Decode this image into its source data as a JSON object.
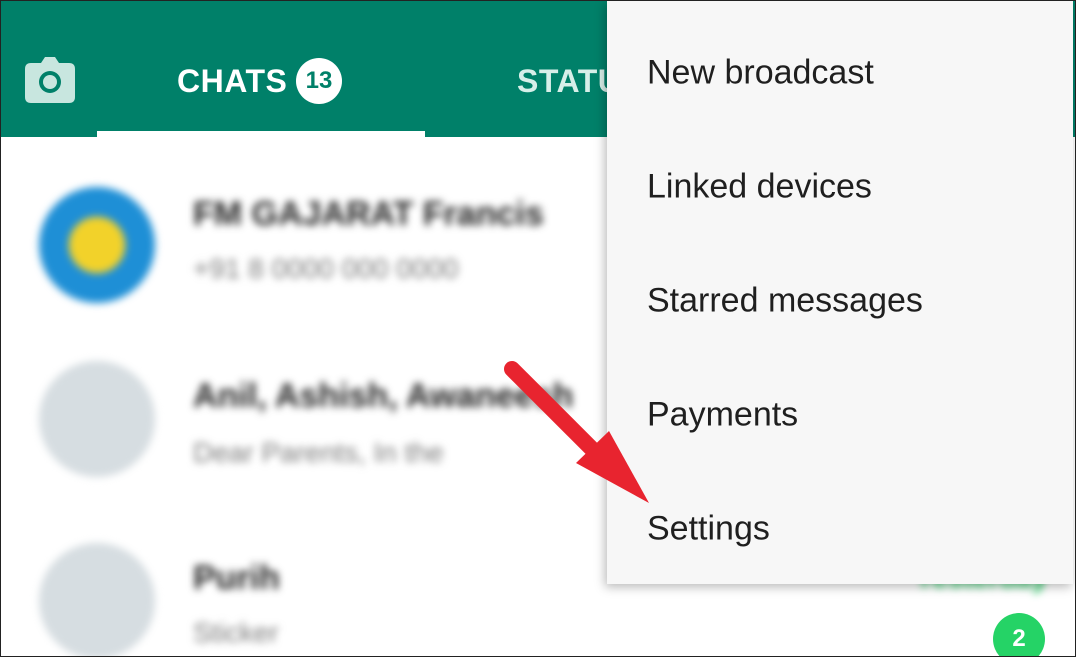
{
  "header": {
    "tabs": {
      "chats": {
        "label": "CHATS",
        "badge": "13"
      },
      "status": {
        "label": "STATUS"
      }
    }
  },
  "chat_list": [
    {
      "name": "FM GAJARAT Francis",
      "preview": "+91 8 0000 000 0000",
      "avatar_color": "#1e8fd6"
    },
    {
      "name": "Anil, Ashish, Awaneesh",
      "preview": "Dear Parents, In the",
      "avatar_color": "#d6dde1"
    },
    {
      "name": "Purih",
      "preview": "Sticker",
      "avatar_color": "#d6dde1",
      "time": "Yesterday",
      "unread": "2"
    }
  ],
  "overflow_menu": {
    "items": [
      {
        "label": "New broadcast"
      },
      {
        "label": "Linked devices"
      },
      {
        "label": "Starred messages"
      },
      {
        "label": "Payments"
      },
      {
        "label": "Settings"
      }
    ]
  },
  "annotation": {
    "arrow_color": "#e8242f"
  },
  "colors": {
    "accent": "#008069",
    "unread": "#25d366"
  }
}
